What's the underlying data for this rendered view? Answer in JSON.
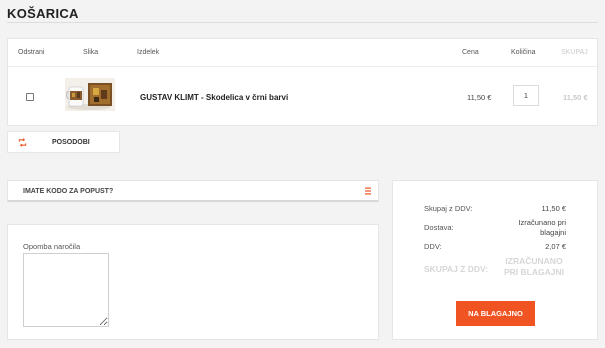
{
  "page": {
    "title": "KOŠARICA"
  },
  "cart": {
    "headers": {
      "remove": "Odstrani",
      "image": "Slika",
      "product": "Izdelek",
      "price": "Cena",
      "quantity": "Količina",
      "total": "SKUPAJ"
    },
    "items": [
      {
        "name": "GUSTAV KLIMT - Skodelica v črni barvi",
        "price": "11,50 €",
        "quantity": "1",
        "total": "11,50 €",
        "thumbnail_icon": "mug-and-box-image"
      }
    ],
    "update_label": "POSODOBI",
    "update_icon": "refresh-icon"
  },
  "coupon": {
    "label": "IMATE KODO ZA POPUST?",
    "toggle_icon": "menu-toggle-icon"
  },
  "note": {
    "label": "Opomba naročila",
    "value": ""
  },
  "summary": {
    "subtotal_label": "Skupaj z DDV:",
    "subtotal_value": "11,50 €",
    "shipping_label": "Dostava:",
    "shipping_value": "Izračunano pri blagajni",
    "vat_label": "DDV:",
    "vat_value": "2,07 €",
    "total_label": "SKUPAJ Z DDV:",
    "total_value": "IZRAČUNANO PRI BLAGAJNI",
    "checkout_label": "NA BLAGAJNO"
  },
  "colors": {
    "accent": "#f05423",
    "muted": "#c9c9c9"
  }
}
